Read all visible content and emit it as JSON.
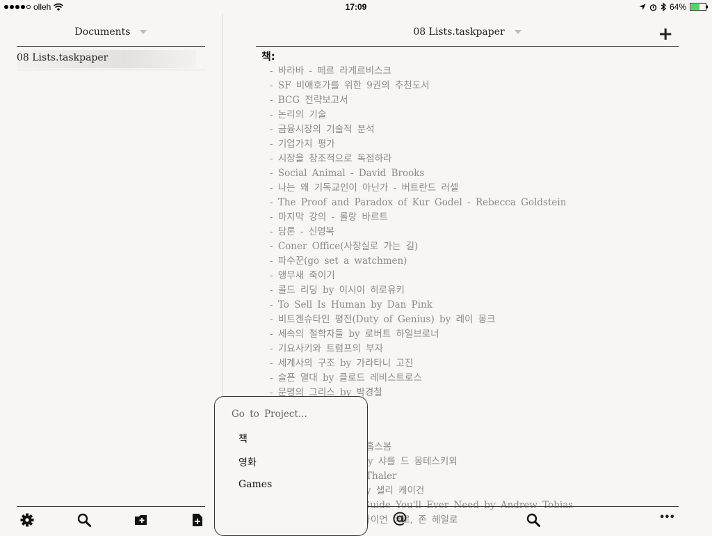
{
  "status_bar": {
    "carrier": "olleh",
    "time": "17:09",
    "battery": "64%",
    "battery_level": 0.64
  },
  "sidebar": {
    "title": "Documents",
    "documents": [
      {
        "name": "08  Lists.taskpaper",
        "selected": true
      }
    ],
    "toolbar": [
      "gear-icon",
      "search-icon",
      "new-folder-icon",
      "new-document-icon"
    ]
  },
  "main": {
    "title": "08  Lists.taskpaper",
    "add_label": "+",
    "project": "책:",
    "tasks": [
      "- 바라바 - 페르 라게르비스크",
      "- SF 비애호가를 위한 9권의 추천도서",
      "- BCG 전략보고서",
      "- 논리의 기술",
      "- 금융시장의 기술적 분석",
      "- 기업가치 평가",
      "- 시장을 창조적으로 독점하라",
      "- Social Animal - David Brooks",
      "- 나는 왜 기독교인이 아닌가 - 버트란드 러셀",
      "- The Proof and Paradox of Kur Godel - Rebecca Goldstein",
      "- 마지막 강의 - 롤랑 바르트",
      "- 담론 - 신영복",
      "- Coner Office(사장실로 가는 길)",
      "- 파수꾼(go set a watchmen)",
      "- 앵무새 죽이기",
      "- 콜드 리딩 by 이시이 히로유키",
      "- To Sell Is Human by Dan Pink",
      "- 비트겐슈타인 평전(Duty of Genius) by 레이 몽크",
      "- 세속의 철학자들 by 로버트 하일브로너",
      "- 기요사키와 트럼프의 부자",
      "- 세계사의 구조 by 가라타니 고진",
      "- 슬픈 열대 by 클로드 레비스트로스",
      "- 문명의 그리스 by 박경철"
    ],
    "partial_tasks": [
      "홉스봄",
      "국의 실패 by 샤를 드 몽테스키외",
      "Thaler",
      "y 샐리 케이건",
      "nt Guide You'll Ever Need by Andrew Tobias",
      "브라이언 버로, 존 헤일로"
    ],
    "toolbar": [
      "at-icon",
      "search-icon",
      "more-icon"
    ],
    "at_label": "@",
    "more_label": "•••"
  },
  "popup": {
    "title": "Go to Project...",
    "items": [
      "책",
      "영화",
      "Games"
    ]
  }
}
